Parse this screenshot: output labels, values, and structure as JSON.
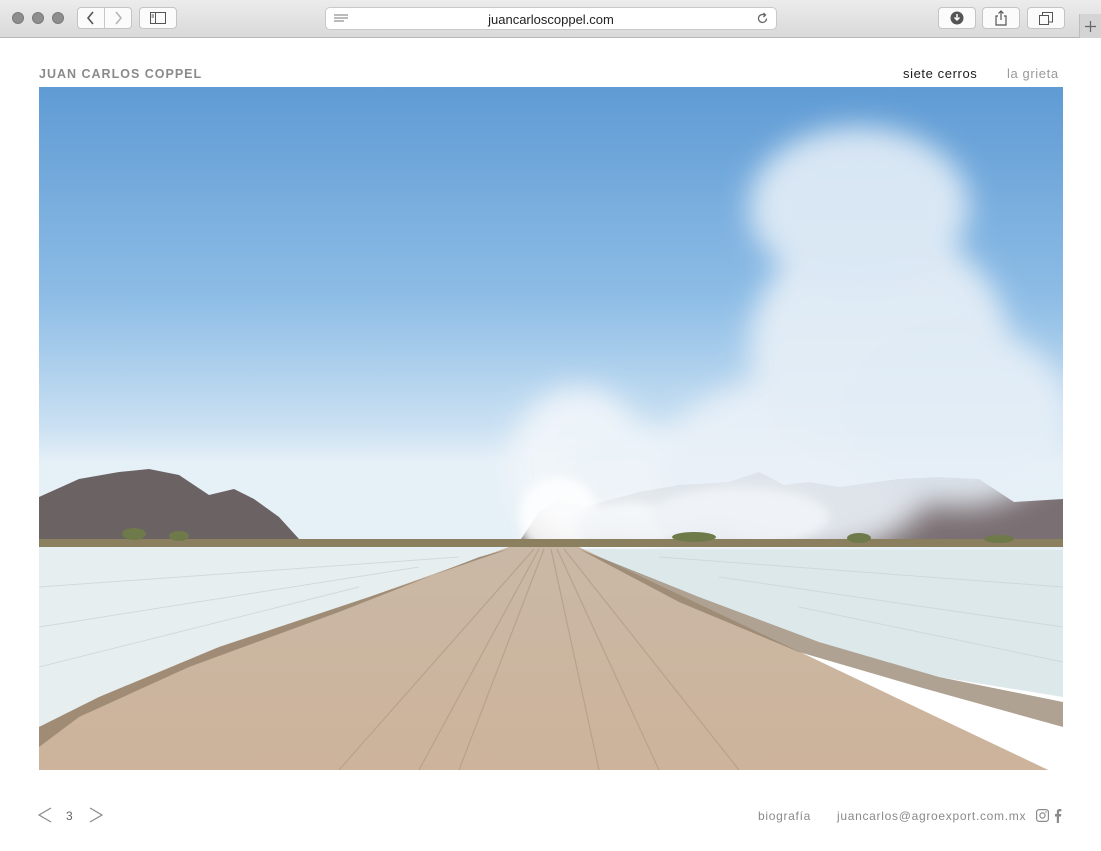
{
  "browser": {
    "url": "juancarloscoppel.com"
  },
  "header": {
    "site_title": "JUAN CARLOS COPPEL",
    "nav": [
      {
        "label": "siete cerros",
        "active": true
      },
      {
        "label": "la grieta",
        "active": false
      }
    ]
  },
  "gallery": {
    "page_number": "3"
  },
  "footer": {
    "bio_label": "biografía",
    "email": "juancarlos@agroexport.com.mx",
    "social": [
      "instagram-icon",
      "facebook-icon"
    ]
  },
  "colors": {
    "title_gray": "#8a8a8a",
    "active_link": "#1c1c1c",
    "inactive_link": "#9a9a9a"
  }
}
